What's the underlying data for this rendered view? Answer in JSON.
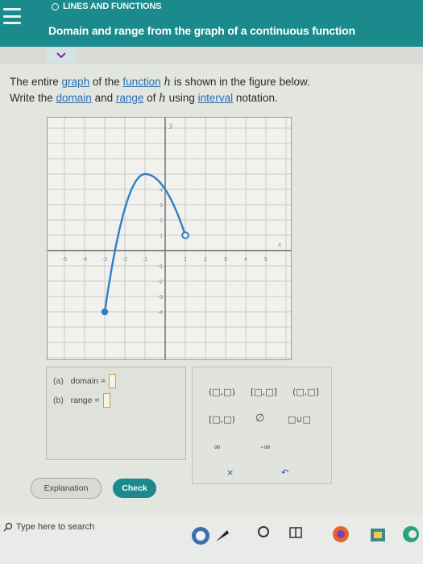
{
  "header": {
    "topic": "LINES AND FUNCTIONS",
    "title": "Domain and range from the graph of a continuous function"
  },
  "prompt": {
    "line1_a": "The entire ",
    "link_graph": "graph",
    "line1_b": " of the ",
    "link_function": "function",
    "fn_name": "h",
    "line1_c": " is shown in the figure below.",
    "line2_a": "Write the ",
    "link_domain": "domain",
    "line2_b": " and ",
    "link_range": "range",
    "line2_c": " of ",
    "fn_name2": "h",
    "line2_d": " using ",
    "link_interval": "interval",
    "line2_e": " notation."
  },
  "graph": {
    "y_label": "y",
    "x_label": "x",
    "x_ticks": [
      "-5",
      "-4",
      "-3",
      "-2",
      "-1",
      "1",
      "2",
      "3",
      "4",
      "5"
    ],
    "y_ticks": [
      "4",
      "3",
      "2",
      "1",
      "-1",
      "-2",
      "-3",
      "-4"
    ]
  },
  "chart_data": {
    "type": "line",
    "xlim": [
      -6,
      6
    ],
    "ylim": [
      -5,
      5
    ],
    "curve": {
      "start_point": {
        "x": -3,
        "y": -4,
        "closed": true
      },
      "vertex": {
        "x": -1,
        "y": 5
      },
      "end_point": {
        "x": 1,
        "y": 1,
        "closed": false
      }
    }
  },
  "answer": {
    "a_tag": "(a)",
    "a_label": "domain =",
    "b_tag": "(b)",
    "b_label": "range ="
  },
  "keypad": {
    "open_open": "(□,□)",
    "closed_closed": "[□,□]",
    "open_closed": "(□,□]",
    "closed_open": "[□,□)",
    "empty_set": "∅",
    "union": "□∪□",
    "infinity": "∞",
    "neg_infinity": "-∞",
    "clear": "×",
    "undo": "↶"
  },
  "buttons": {
    "explanation": "Explanation",
    "check": "Check"
  },
  "taskbar": {
    "search_placeholder": "Type here to search"
  }
}
